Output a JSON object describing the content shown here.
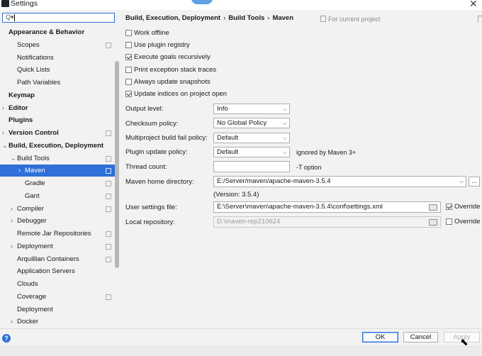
{
  "window": {
    "title": "Settings"
  },
  "search": {
    "value": ""
  },
  "tree": [
    {
      "label": "Appearance & Behavior",
      "level": 0,
      "bold": true,
      "arrow": "",
      "config": false,
      "selected": false
    },
    {
      "label": "Scopes",
      "level": 1,
      "bold": false,
      "arrow": "",
      "config": true,
      "selected": false
    },
    {
      "label": "Notifications",
      "level": 1,
      "bold": false,
      "arrow": "",
      "config": false,
      "selected": false
    },
    {
      "label": "Quick Lists",
      "level": 1,
      "bold": false,
      "arrow": "",
      "config": false,
      "selected": false
    },
    {
      "label": "Path Variables",
      "level": 1,
      "bold": false,
      "arrow": "",
      "config": false,
      "selected": false
    },
    {
      "label": "Keymap",
      "level": 0,
      "bold": true,
      "arrow": "",
      "config": false,
      "selected": false
    },
    {
      "label": "Editor",
      "level": 0,
      "bold": true,
      "arrow": "›",
      "config": false,
      "selected": false
    },
    {
      "label": "Plugins",
      "level": 0,
      "bold": true,
      "arrow": "",
      "config": false,
      "selected": false
    },
    {
      "label": "Version Control",
      "level": 0,
      "bold": true,
      "arrow": "›",
      "config": true,
      "selected": false
    },
    {
      "label": "Build, Execution, Deployment",
      "level": 0,
      "bold": true,
      "arrow": "⌄",
      "config": false,
      "selected": false
    },
    {
      "label": "Build Tools",
      "level": 1,
      "bold": false,
      "arrow": "⌄",
      "config": true,
      "selected": false
    },
    {
      "label": "Maven",
      "level": 2,
      "bold": false,
      "arrow": "›",
      "config": true,
      "selected": true
    },
    {
      "label": "Gradle",
      "level": 2,
      "bold": false,
      "arrow": "",
      "config": true,
      "selected": false
    },
    {
      "label": "Gant",
      "level": 2,
      "bold": false,
      "arrow": "",
      "config": true,
      "selected": false
    },
    {
      "label": "Compiler",
      "level": 1,
      "bold": false,
      "arrow": "›",
      "config": true,
      "selected": false
    },
    {
      "label": "Debugger",
      "level": 1,
      "bold": false,
      "arrow": "›",
      "config": false,
      "selected": false
    },
    {
      "label": "Remote Jar Repositories",
      "level": 1,
      "bold": false,
      "arrow": "",
      "config": true,
      "selected": false
    },
    {
      "label": "Deployment",
      "level": 1,
      "bold": false,
      "arrow": "›",
      "config": true,
      "selected": false
    },
    {
      "label": "Arquillian Containers",
      "level": 1,
      "bold": false,
      "arrow": "",
      "config": true,
      "selected": false
    },
    {
      "label": "Application Servers",
      "level": 1,
      "bold": false,
      "arrow": "",
      "config": false,
      "selected": false
    },
    {
      "label": "Clouds",
      "level": 1,
      "bold": false,
      "arrow": "",
      "config": false,
      "selected": false
    },
    {
      "label": "Coverage",
      "level": 1,
      "bold": false,
      "arrow": "",
      "config": true,
      "selected": false
    },
    {
      "label": "Deployment",
      "level": 1,
      "bold": false,
      "arrow": "",
      "config": false,
      "selected": false
    },
    {
      "label": "Docker",
      "level": 1,
      "bold": false,
      "arrow": "›",
      "config": false,
      "selected": false
    }
  ],
  "breadcrumb": {
    "part1": "Build, Execution, Deployment",
    "sep": "›",
    "part2": "Build Tools",
    "part3": "Maven"
  },
  "for_current_project": "For current project",
  "checkboxes": [
    {
      "label": "Work offline",
      "checked": false
    },
    {
      "label": "Use plugin registry",
      "checked": false
    },
    {
      "label": "Execute goals recursively",
      "checked": true
    },
    {
      "label": "Print exception stack traces",
      "checked": false
    },
    {
      "label": "Always update snapshots",
      "checked": false
    },
    {
      "label": "Update indices on project open",
      "checked": true
    }
  ],
  "fields": {
    "output_level": {
      "label": "Output level:",
      "value": "Info"
    },
    "checksum_policy": {
      "label": "Checksum policy:",
      "value": "No Global Policy"
    },
    "multiproject_fail_policy": {
      "label": "Multiproject build fail policy:",
      "value": "Default"
    },
    "plugin_update_policy": {
      "label": "Plugin update policy:",
      "value": "Default",
      "hint": "ignored by Maven 3+"
    },
    "thread_count": {
      "label": "Thread count:",
      "value": "",
      "hint": "-T option"
    },
    "maven_home": {
      "label": "Maven home directory:",
      "value": "E:/Server/maven/apache-maven-3.5.4",
      "version": "(Version: 3.5.4)",
      "browse": "..."
    },
    "user_settings": {
      "label": "User settings file:",
      "value": "E:\\Server\\maven\\apache-maven-3.5.4\\conf\\settings.xml",
      "override_label": "Override",
      "override_checked": true
    },
    "local_repo": {
      "label": "Local repository:",
      "value": "D:\\maven-rep210624",
      "override_label": "Override",
      "override_checked": false
    }
  },
  "buttons": {
    "ok": "OK",
    "cancel": "Cancel",
    "apply": "Apply",
    "help": "?"
  }
}
